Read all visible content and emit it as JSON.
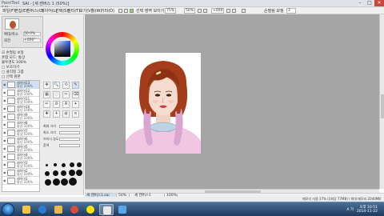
{
  "window": {
    "logo": "PaintTool SAI",
    "title": "SAI - [새 캔버스 1 (50%)]",
    "minimize": "–",
    "maximize": "□",
    "close": "✕"
  },
  "menu": {
    "items": [
      "파일(F)",
      "편집(E)",
      "캔버스(C)",
      "레이어(L)",
      "선택(S)",
      "필터(T)",
      "보기(V)",
      "창(W)",
      "기타(O)"
    ],
    "zoom_value": "50%",
    "angle_value": "+000",
    "stabilizer_label": "손떨림 보정",
    "stabilizer_value": "3",
    "selection_label": "선택 영역 보이기",
    "selection_value": "75%"
  },
  "navigator": {
    "zoom_label": "확대/축소",
    "zoom_value": "50.0%",
    "rotate_label": "회전",
    "rotate_value": "+000°"
  },
  "panel_options": [
    "☑ 손떨림 보정",
    "혼합 모드: 통상",
    "불투명도 100%",
    "□ 보호하기",
    "□ 클리핑 그룹",
    "□ 선택 원본"
  ],
  "layers": [
    {
      "name": "레이어13",
      "mode": "통상 100%"
    },
    {
      "name": "레이어12",
      "mode": "통상 100%"
    },
    {
      "name": "레이어11",
      "mode": "통상 100%"
    },
    {
      "name": "레이어10",
      "mode": "통상 100%"
    },
    {
      "name": "레이어9",
      "mode": "통상 100%"
    },
    {
      "name": "레이어8",
      "mode": "통상 100%"
    },
    {
      "name": "레이어7",
      "mode": "통상 100%"
    },
    {
      "name": "레이어6",
      "mode": "통상 100%"
    },
    {
      "name": "레이어5",
      "mode": "통상 100%"
    },
    {
      "name": "레이어4",
      "mode": "통상 100%"
    },
    {
      "name": "레이어3",
      "mode": "통상 100%"
    },
    {
      "name": "레이어2",
      "mode": "통상 100%"
    },
    {
      "name": "레이어1",
      "mode": "통상 100%"
    }
  ],
  "tools": [
    "✥",
    "🔍",
    "⟲",
    "✎",
    "▦",
    "◌",
    "✂",
    "⌫",
    "✏",
    "⊘",
    "A",
    "✦",
    "✚",
    "✈",
    "◍",
    "≋"
  ],
  "brush_settings": [
    {
      "label": "최대 크기",
      "value": "5.0"
    },
    {
      "label": "최소 크기",
      "value": "0%"
    },
    {
      "label": "브러시 농도",
      "value": "100"
    },
    {
      "label": "혼색",
      "value": "0"
    }
  ],
  "document_tab": "새 캔버스1.sai",
  "document_zoom": "50%",
  "second_tab": "새 캔버스1",
  "second_tab_zoom": "100%",
  "status_text": "메모리 사용 37% (1회당 77MB) / 최대 메모리 2040MB",
  "taskbar": {
    "apps": [
      {
        "name": "explorer",
        "color": "#f5c542"
      },
      {
        "name": "ie",
        "color": "#2b7bd6"
      },
      {
        "name": "folder",
        "color": "#e8b84a"
      },
      {
        "name": "chrome",
        "color": "#d94b3a"
      },
      {
        "name": "kakao",
        "color": "#ffe400"
      },
      {
        "name": "sai",
        "color": "#e9e9e9"
      },
      {
        "name": "paint",
        "color": "#5aa5e8"
      }
    ],
    "lang": "A 가",
    "time": "오후 10:51",
    "date": "2014-11-22"
  },
  "colors": {
    "canvas_bg": "#a5a5a5",
    "hair": "#a33d1b",
    "skin": "#f6dccf",
    "sweater": "#f0c6e3",
    "collar": "#bcd4e6",
    "accent": "#cfe0f5"
  }
}
